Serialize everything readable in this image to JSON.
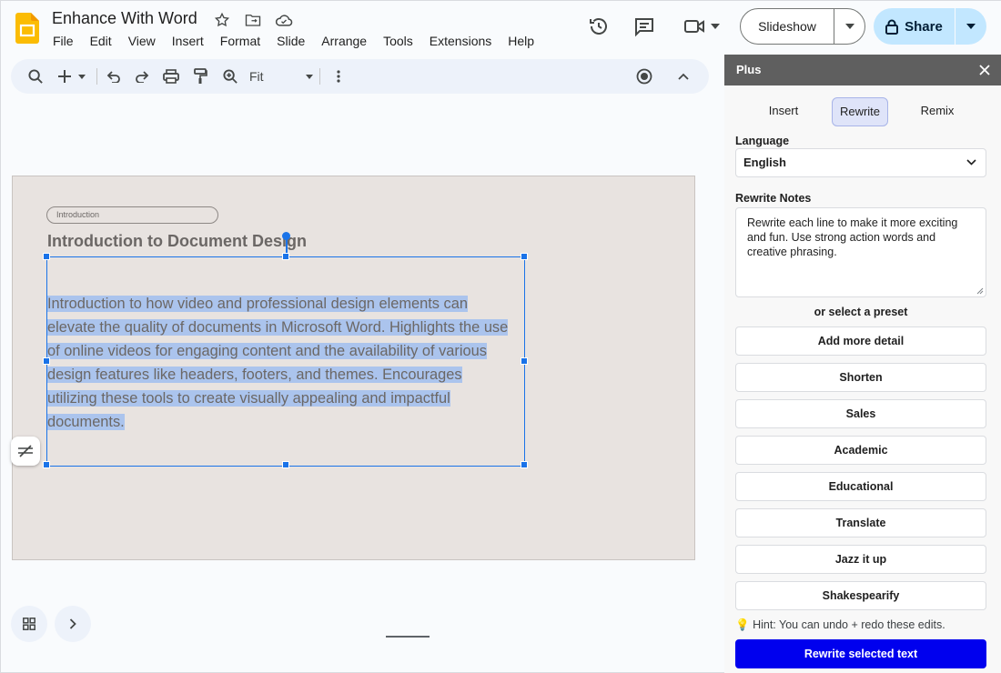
{
  "doc": {
    "title": "Enhance With Word"
  },
  "menu": [
    "File",
    "Edit",
    "View",
    "Insert",
    "Format",
    "Slide",
    "Arrange",
    "Tools",
    "Extensions",
    "Help"
  ],
  "header": {
    "slideshow_label": "Slideshow",
    "share_label": "Share"
  },
  "toolbar": {
    "zoom_value": "Fit"
  },
  "slide": {
    "pill_label": "Introduction",
    "title": "Introduction to Document Design",
    "body_lines": [
      "Introduction to how video and professional design elements can",
      "elevate the quality of documents in Microsoft Word. Highlights the use",
      "of online videos for engaging content and the availability of various",
      "design features like headers, footers, and themes. Encourages",
      "utilizing these tools to create visually appealing and impactful",
      "documents."
    ]
  },
  "panel": {
    "title": "Plus",
    "tabs": [
      "Insert",
      "Rewrite",
      "Remix"
    ],
    "active_tab": "Rewrite",
    "language_label": "Language",
    "language_value": "English",
    "notes_label": "Rewrite Notes",
    "notes_value": "Rewrite each line to make it more exciting and fun. Use strong action words and creative phrasing.",
    "or_preset": "or select a preset",
    "presets": [
      "Add more detail",
      "Shorten",
      "Sales",
      "Academic",
      "Educational",
      "Translate",
      "Jazz it up",
      "Shakespearify"
    ],
    "hint": "Hint: You can undo + redo these edits.",
    "rewrite_button": "Rewrite selected text"
  },
  "colors": {
    "accent": "#1a73e8",
    "share_bg": "#c2e7ff",
    "rewrite_btn": "#0000ee",
    "selection": "#abc4ed"
  },
  "icons": [
    "search-icon",
    "add-icon",
    "undo-icon",
    "redo-icon",
    "print-icon",
    "paint-format-icon",
    "zoom-icon",
    "more-vert-icon",
    "record-icon",
    "collapse-icon",
    "history-icon",
    "comment-icon",
    "video-icon",
    "lock-icon",
    "star-icon",
    "move-icon",
    "cloud-icon",
    "grid-view-icon",
    "chevron-right-icon",
    "close-icon",
    "lightbulb-icon"
  ]
}
